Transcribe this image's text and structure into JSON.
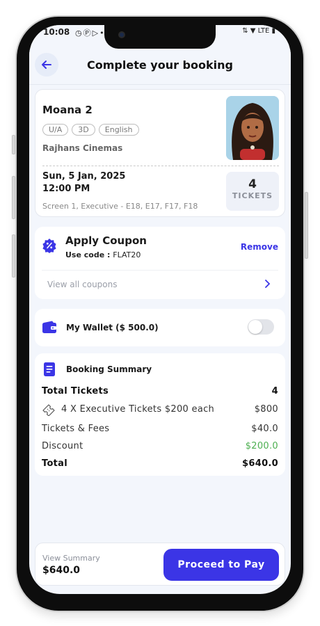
{
  "status_bar": {
    "time": "10:08",
    "left_icons": [
      "whatsapp-icon",
      "pay-icon",
      "play-icon",
      "dot"
    ],
    "right_icons": [
      "data-arrows-icon",
      "wifi-icon",
      "lte-signal-icon",
      "battery-icon"
    ],
    "net_label": "LTE"
  },
  "header": {
    "title": "Complete your booking"
  },
  "movie": {
    "title": "Moana 2",
    "tags": [
      "U/A",
      "3D",
      "English"
    ],
    "cinema": "Rajhans Cinemas",
    "date": "Sun, 5 Jan, 2025",
    "time": "12:00 PM",
    "seats": "Screen 1, Executive - E18, E17, F17, F18",
    "ticket_count": "4",
    "ticket_label": "TICKETS"
  },
  "coupon": {
    "title": "Apply Coupon",
    "code_prefix": "Use code : ",
    "code": "FLAT20",
    "remove_label": "Remove",
    "view_all_label": "View all coupons"
  },
  "wallet": {
    "label": "My Wallet ($ 500.0)",
    "enabled": false
  },
  "summary": {
    "title": "Booking Summary",
    "total_tickets_label": "Total Tickets",
    "total_tickets_value": "4",
    "ticket_line_label": "4 X Executive Tickets $200 each",
    "ticket_line_value": "$800",
    "fees_label": "Tickets & Fees",
    "fees_value": "$40.0",
    "discount_label": "Discount",
    "discount_value": "$200.0",
    "total_label": "Total",
    "total_value": "$640.0"
  },
  "footer": {
    "view_summary_label": "View Summary",
    "amount": "$640.0",
    "pay_label": "Proceed to Pay"
  },
  "colors": {
    "accent": "#3b35e6",
    "discount_green": "#4caf50",
    "background": "#f3f6fc"
  }
}
